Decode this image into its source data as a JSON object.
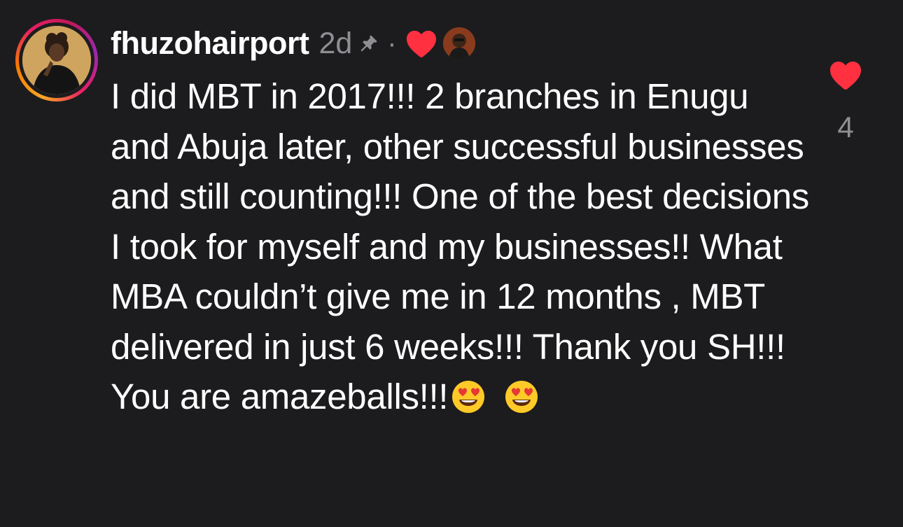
{
  "comment": {
    "username": "fhuzohairport",
    "time": "2d",
    "separator": "·",
    "text": "I did MBT in 2017!!! 2 branches in Enugu and Abuja later, other successful businesses and still counting!!! One of the best decisions I took for myself and my businesses!! What MBA couldn’t give me in 12 months , MBT delivered in just 6 weeks!!! Thank you SH!!! You are amazeballs!!!",
    "emojis": [
      "heart-eyes-emoji",
      "heart-eyes-emoji"
    ],
    "like_count": "4",
    "pinned": true,
    "liked_by_creator": true,
    "icons": {
      "pin": "pin-icon",
      "creator_heart": "heart-icon",
      "like": "heart-icon"
    },
    "colors": {
      "background": "#1c1c1e",
      "heart": "#ff3040",
      "secondary_text": "#8e8e93"
    }
  }
}
